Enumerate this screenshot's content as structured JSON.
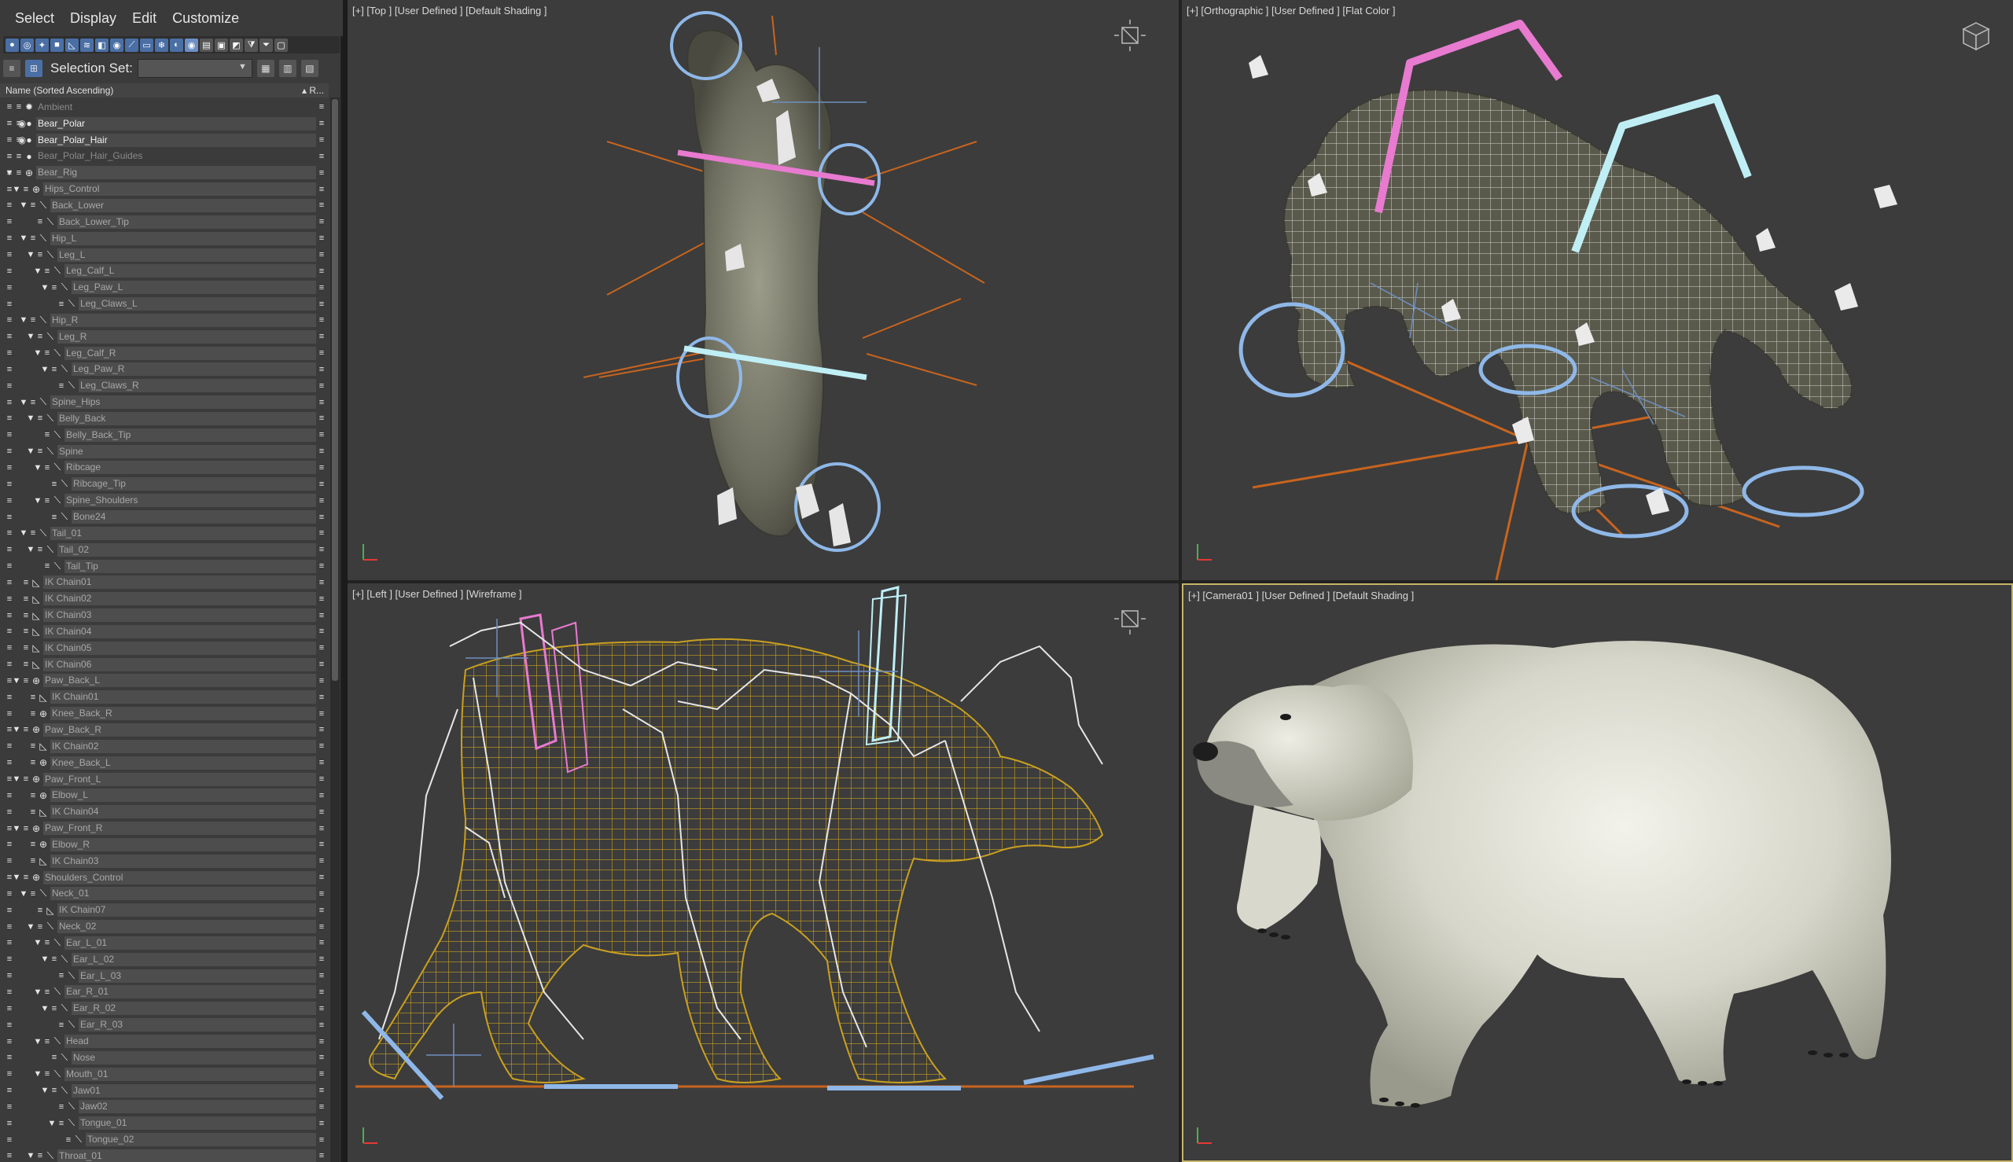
{
  "menubar": {
    "items": [
      "Select",
      "Display",
      "Edit",
      "Customize"
    ]
  },
  "toolbar": {
    "selection_set_label": "Selection Set:",
    "selection_set_value": ""
  },
  "explorer": {
    "column_name": "Name (Sorted Ascending)",
    "column_r": "▴ R...",
    "rows": [
      {
        "label": "Ambient",
        "depth": 0,
        "type": "light",
        "arrow": "",
        "eye": false,
        "style": "dim"
      },
      {
        "label": "Bear_Polar",
        "depth": 0,
        "type": "mesh",
        "arrow": "",
        "eye": true,
        "style": "hi"
      },
      {
        "label": "Bear_Polar_Hair",
        "depth": 0,
        "type": "mesh",
        "arrow": "",
        "eye": true,
        "style": "hi"
      },
      {
        "label": "Bear_Polar_Hair_Guides",
        "depth": 0,
        "type": "mesh",
        "arrow": "",
        "eye": false,
        "style": "dim"
      },
      {
        "label": "Bear_Rig",
        "depth": 0,
        "type": "group",
        "arrow": "▼",
        "eye": false,
        "style": ""
      },
      {
        "label": "Hips_Control",
        "depth": 1,
        "type": "helper",
        "arrow": "▼",
        "eye": false,
        "style": ""
      },
      {
        "label": "Back_Lower",
        "depth": 2,
        "type": "bone",
        "arrow": "▼",
        "eye": false,
        "style": ""
      },
      {
        "label": "Back_Lower_Tip",
        "depth": 3,
        "type": "bone",
        "arrow": "",
        "eye": false,
        "style": ""
      },
      {
        "label": "Hip_L",
        "depth": 2,
        "type": "bone",
        "arrow": "▼",
        "eye": false,
        "style": ""
      },
      {
        "label": "Leg_L",
        "depth": 3,
        "type": "bone",
        "arrow": "▼",
        "eye": false,
        "style": ""
      },
      {
        "label": "Leg_Calf_L",
        "depth": 4,
        "type": "bone",
        "arrow": "▼",
        "eye": false,
        "style": ""
      },
      {
        "label": "Leg_Paw_L",
        "depth": 5,
        "type": "bone",
        "arrow": "▼",
        "eye": false,
        "style": ""
      },
      {
        "label": "Leg_Claws_L",
        "depth": 6,
        "type": "bone",
        "arrow": "",
        "eye": false,
        "style": ""
      },
      {
        "label": "Hip_R",
        "depth": 2,
        "type": "bone",
        "arrow": "▼",
        "eye": false,
        "style": ""
      },
      {
        "label": "Leg_R",
        "depth": 3,
        "type": "bone",
        "arrow": "▼",
        "eye": false,
        "style": ""
      },
      {
        "label": "Leg_Calf_R",
        "depth": 4,
        "type": "bone",
        "arrow": "▼",
        "eye": false,
        "style": ""
      },
      {
        "label": "Leg_Paw_R",
        "depth": 5,
        "type": "bone",
        "arrow": "▼",
        "eye": false,
        "style": ""
      },
      {
        "label": "Leg_Claws_R",
        "depth": 6,
        "type": "bone",
        "arrow": "",
        "eye": false,
        "style": ""
      },
      {
        "label": "Spine_Hips",
        "depth": 2,
        "type": "bone",
        "arrow": "▼",
        "eye": false,
        "style": ""
      },
      {
        "label": "Belly_Back",
        "depth": 3,
        "type": "bone",
        "arrow": "▼",
        "eye": false,
        "style": ""
      },
      {
        "label": "Belly_Back_Tip",
        "depth": 4,
        "type": "bone",
        "arrow": "",
        "eye": false,
        "style": ""
      },
      {
        "label": "Spine",
        "depth": 3,
        "type": "bone",
        "arrow": "▼",
        "eye": false,
        "style": ""
      },
      {
        "label": "Ribcage",
        "depth": 4,
        "type": "bone",
        "arrow": "▼",
        "eye": false,
        "style": ""
      },
      {
        "label": "Ribcage_Tip",
        "depth": 5,
        "type": "bone",
        "arrow": "",
        "eye": false,
        "style": ""
      },
      {
        "label": "Spine_Shoulders",
        "depth": 4,
        "type": "bone",
        "arrow": "▼",
        "eye": false,
        "style": ""
      },
      {
        "label": "Bone24",
        "depth": 5,
        "type": "bone",
        "arrow": "",
        "eye": false,
        "style": ""
      },
      {
        "label": "Tail_01",
        "depth": 2,
        "type": "bone",
        "arrow": "▼",
        "eye": false,
        "style": ""
      },
      {
        "label": "Tail_02",
        "depth": 3,
        "type": "bone",
        "arrow": "▼",
        "eye": false,
        "style": ""
      },
      {
        "label": "Tail_Tip",
        "depth": 4,
        "type": "bone",
        "arrow": "",
        "eye": false,
        "style": ""
      },
      {
        "label": "IK Chain01",
        "depth": 1,
        "type": "ik",
        "arrow": "",
        "eye": false,
        "style": ""
      },
      {
        "label": "IK Chain02",
        "depth": 1,
        "type": "ik",
        "arrow": "",
        "eye": false,
        "style": ""
      },
      {
        "label": "IK Chain03",
        "depth": 1,
        "type": "ik",
        "arrow": "",
        "eye": false,
        "style": ""
      },
      {
        "label": "IK Chain04",
        "depth": 1,
        "type": "ik",
        "arrow": "",
        "eye": false,
        "style": ""
      },
      {
        "label": "IK Chain05",
        "depth": 1,
        "type": "ik",
        "arrow": "",
        "eye": false,
        "style": ""
      },
      {
        "label": "IK Chain06",
        "depth": 1,
        "type": "ik",
        "arrow": "",
        "eye": false,
        "style": ""
      },
      {
        "label": "Paw_Back_L",
        "depth": 1,
        "type": "helper",
        "arrow": "▼",
        "eye": false,
        "style": ""
      },
      {
        "label": "IK Chain01",
        "depth": 2,
        "type": "ik",
        "arrow": "",
        "eye": false,
        "style": ""
      },
      {
        "label": "Knee_Back_R",
        "depth": 2,
        "type": "helper",
        "arrow": "",
        "eye": false,
        "style": ""
      },
      {
        "label": "Paw_Back_R",
        "depth": 1,
        "type": "helper",
        "arrow": "▼",
        "eye": false,
        "style": ""
      },
      {
        "label": "IK Chain02",
        "depth": 2,
        "type": "ik",
        "arrow": "",
        "eye": false,
        "style": ""
      },
      {
        "label": "Knee_Back_L",
        "depth": 2,
        "type": "helper",
        "arrow": "",
        "eye": false,
        "style": ""
      },
      {
        "label": "Paw_Front_L",
        "depth": 1,
        "type": "helper",
        "arrow": "▼",
        "eye": false,
        "style": ""
      },
      {
        "label": "Elbow_L",
        "depth": 2,
        "type": "helper",
        "arrow": "",
        "eye": false,
        "style": ""
      },
      {
        "label": "IK Chain04",
        "depth": 2,
        "type": "ik",
        "arrow": "",
        "eye": false,
        "style": ""
      },
      {
        "label": "Paw_Front_R",
        "depth": 1,
        "type": "helper",
        "arrow": "▼",
        "eye": false,
        "style": ""
      },
      {
        "label": "Elbow_R",
        "depth": 2,
        "type": "helper",
        "arrow": "",
        "eye": false,
        "style": ""
      },
      {
        "label": "IK Chain03",
        "depth": 2,
        "type": "ik",
        "arrow": "",
        "eye": false,
        "style": ""
      },
      {
        "label": "Shoulders_Control",
        "depth": 1,
        "type": "helper",
        "arrow": "▼",
        "eye": false,
        "style": ""
      },
      {
        "label": "Neck_01",
        "depth": 2,
        "type": "bone",
        "arrow": "▼",
        "eye": false,
        "style": ""
      },
      {
        "label": "IK Chain07",
        "depth": 3,
        "type": "ik",
        "arrow": "",
        "eye": false,
        "style": ""
      },
      {
        "label": "Neck_02",
        "depth": 3,
        "type": "bone",
        "arrow": "▼",
        "eye": false,
        "style": ""
      },
      {
        "label": "Ear_L_01",
        "depth": 4,
        "type": "bone",
        "arrow": "▼",
        "eye": false,
        "style": ""
      },
      {
        "label": "Ear_L_02",
        "depth": 5,
        "type": "bone",
        "arrow": "▼",
        "eye": false,
        "style": ""
      },
      {
        "label": "Ear_L_03",
        "depth": 6,
        "type": "bone",
        "arrow": "",
        "eye": false,
        "style": ""
      },
      {
        "label": "Ear_R_01",
        "depth": 4,
        "type": "bone",
        "arrow": "▼",
        "eye": false,
        "style": ""
      },
      {
        "label": "Ear_R_02",
        "depth": 5,
        "type": "bone",
        "arrow": "▼",
        "eye": false,
        "style": ""
      },
      {
        "label": "Ear_R_03",
        "depth": 6,
        "type": "bone",
        "arrow": "",
        "eye": false,
        "style": ""
      },
      {
        "label": "Head",
        "depth": 4,
        "type": "bone",
        "arrow": "▼",
        "eye": false,
        "style": ""
      },
      {
        "label": "Nose",
        "depth": 5,
        "type": "bone",
        "arrow": "",
        "eye": false,
        "style": ""
      },
      {
        "label": "Mouth_01",
        "depth": 4,
        "type": "bone",
        "arrow": "▼",
        "eye": false,
        "style": ""
      },
      {
        "label": "Jaw01",
        "depth": 5,
        "type": "bone",
        "arrow": "▼",
        "eye": false,
        "style": ""
      },
      {
        "label": "Jaw02",
        "depth": 6,
        "type": "bone",
        "arrow": "",
        "eye": false,
        "style": ""
      },
      {
        "label": "Tongue_01",
        "depth": 6,
        "type": "bone",
        "arrow": "▼",
        "eye": false,
        "style": ""
      },
      {
        "label": "Tongue_02",
        "depth": 7,
        "type": "bone",
        "arrow": "",
        "eye": false,
        "style": ""
      },
      {
        "label": "Throat_01",
        "depth": 3,
        "type": "bone",
        "arrow": "▼",
        "eye": false,
        "style": ""
      }
    ]
  },
  "viewports": {
    "top": {
      "label": "[+] [Top ] [User Defined ] [Default Shading ]"
    },
    "ortho": {
      "label": "[+] [Orthographic ] [User Defined ] [Flat Color ]"
    },
    "left": {
      "label": "[+] [Left ] [User Defined ] [Wireframe ]"
    },
    "camera": {
      "label": "[+] [Camera01 ] [User Defined ] [Default Shading ]"
    }
  },
  "colors": {
    "rig_pink": "#e87ad0",
    "rig_cyan": "#bfeff5",
    "rig_blue": "#8fb8e8",
    "rig_orange": "#c8641e",
    "wire_yellow": "#c9a020",
    "active_viewport_border": "#c8b46a"
  }
}
